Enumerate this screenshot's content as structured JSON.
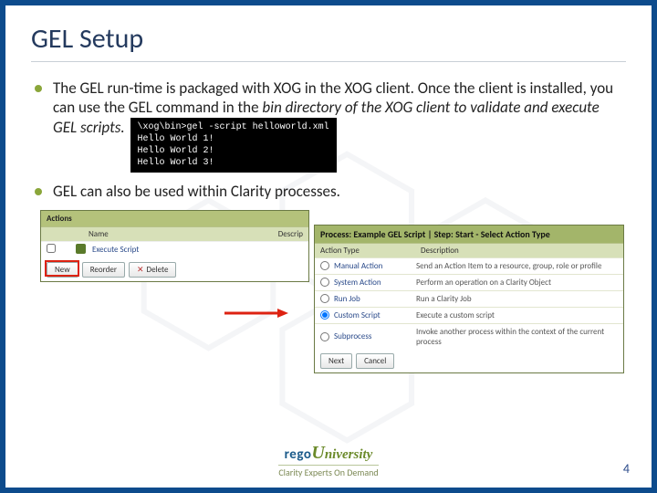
{
  "title": "GEL Setup",
  "bullets": {
    "b1_a": "The GEL run-time is packaged with XOG in the XOG client. Once the client is installed, you can use the GEL command in the ",
    "b1_b": "bin directory of the XOG client to validate and execute GEL scripts.",
    "b2": "GEL can also be used within Clarity processes."
  },
  "terminal": "\\xog\\bin>gel -script helloworld.xml\nHello World 1!\nHello World 2!\nHello World 3!",
  "panel1": {
    "actions": "Actions",
    "col_name": "Name",
    "col_desc": "Descrip",
    "row_exec": "Execute Script",
    "btn_new": "New",
    "btn_reorder": "Reorder",
    "btn_delete": "Delete"
  },
  "panel2": {
    "header": "Process: Example GEL Script | Step: Start - Select Action Type",
    "col_type": "Action Type",
    "col_desc": "Description",
    "rows": [
      {
        "label": "Manual Action",
        "desc": "Send an Action Item to a resource, group, role or profile"
      },
      {
        "label": "System Action",
        "desc": "Perform an operation on a Clarity Object"
      },
      {
        "label": "Run Job",
        "desc": "Run a Clarity Job"
      },
      {
        "label": "Custom Script",
        "desc": "Execute a custom script"
      },
      {
        "label": "Subprocess",
        "desc": "Invoke another process within the context of the current process"
      }
    ],
    "btn_next": "Next",
    "btn_cancel": "Cancel"
  },
  "logo": {
    "rego": "rego",
    "uni": "niversity",
    "U": "U",
    "tagline": "Clarity Experts On Demand"
  },
  "page": "4"
}
